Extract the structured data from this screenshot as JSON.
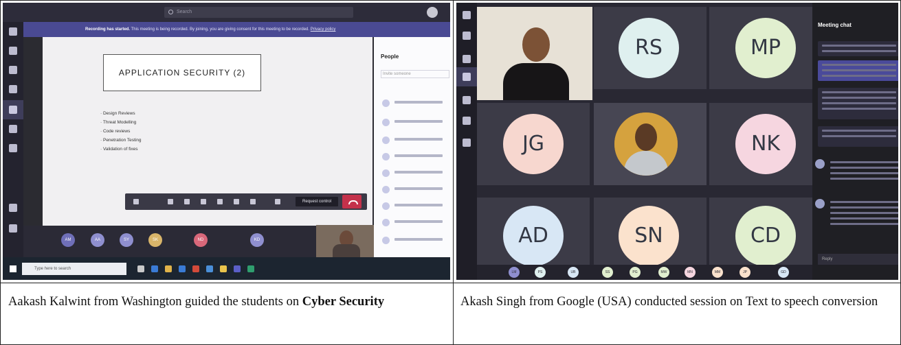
{
  "left_screenshot": {
    "search_placeholder": "Search",
    "recording_notice_bold": "Recording has started.",
    "recording_notice": "This meeting is being recorded. By joining, you are giving consent for this meeting to be recorded.",
    "recording_link": "Privacy policy",
    "slide_title": "APPLICATION SECURITY (2)",
    "slide_bullets": [
      "Design Reviews",
      "Threat Modelling",
      "Code reviews",
      "Penetration Testing",
      "Validation of fixes"
    ],
    "request_control_label": "Request control",
    "people_heading": "People",
    "people_search_placeholder": "Invite someone",
    "video_strip_initials": [
      "AM",
      "AA",
      "SY",
      "SK",
      "ND",
      "KD"
    ],
    "taskbar_search": "Type here to search",
    "colors": {
      "recording_bar": "#4a4a93",
      "hangup": "#c4314b",
      "rail": "#24232f"
    }
  },
  "right_screenshot": {
    "chat_heading": "Meeting chat",
    "reply_placeholder": "Reply",
    "tiles": [
      {
        "initials": "RS",
        "color": "#dff0ef"
      },
      {
        "initials": "MP",
        "color": "#e1efcf"
      },
      {
        "initials": "JG",
        "color": "#f7d7cf"
      },
      {
        "initials": "NK",
        "color": "#f6d6e0"
      },
      {
        "initials": "AD",
        "color": "#d8e7f5"
      },
      {
        "initials": "SN",
        "color": "#fbe2cd"
      },
      {
        "initials": "CD",
        "color": "#e1efcf"
      }
    ],
    "bottom_strip_initials": [
      "LM",
      "PS",
      "UB",
      "SS",
      "PG",
      "MW",
      "MN",
      "MM",
      "JP",
      "GD"
    ]
  },
  "captions": {
    "left_prefix": "Aakash Kalwint from Washington guided the students on ",
    "left_bold": "Cyber Security",
    "right": "Akash Singh from  Google (USA)  conducted session on Text to speech conversion"
  }
}
